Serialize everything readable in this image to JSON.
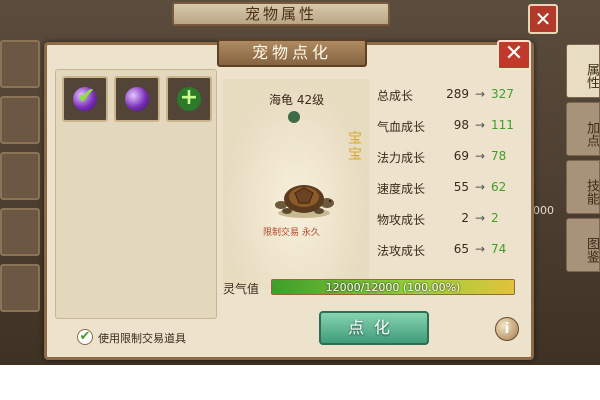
{
  "background_window": {
    "title": "宠物属性",
    "close_label": "✕",
    "right_tabs": [
      "属性",
      "加点",
      "技能",
      "图鉴"
    ],
    "side_value": "000"
  },
  "dialog": {
    "title": "宠物点化",
    "close_label": "✕"
  },
  "items": [
    {
      "type": "orb-check"
    },
    {
      "type": "orb"
    },
    {
      "type": "add"
    }
  ],
  "pet": {
    "name_level": "海龟 42级",
    "badge": "宝宝",
    "trade_note": "限制交易 永久"
  },
  "stats": [
    {
      "label": "总成长",
      "old": "289",
      "arrow": "→",
      "new": "327"
    },
    {
      "label": "气血成长",
      "old": "98",
      "arrow": "→",
      "new": "111"
    },
    {
      "label": "法力成长",
      "old": "69",
      "arrow": "→",
      "new": "78"
    },
    {
      "label": "速度成长",
      "old": "55",
      "arrow": "→",
      "new": "62"
    },
    {
      "label": "物攻成长",
      "old": "2",
      "arrow": "→",
      "new": "2"
    },
    {
      "label": "法攻成长",
      "old": "65",
      "arrow": "→",
      "new": "74"
    }
  ],
  "aura": {
    "label": "灵气值",
    "text": "12000/12000 (100.00%)",
    "fraction": 1.0
  },
  "use_restricted": {
    "checked": true,
    "label": "使用限制交易道具"
  },
  "refine_button": "点化",
  "info_button": "i",
  "colors": {
    "dialog_bg": "#ede3cd",
    "stat_new": "#3f9e28",
    "close_red": "#c0392b",
    "refine_green": "#3f9c7a"
  }
}
